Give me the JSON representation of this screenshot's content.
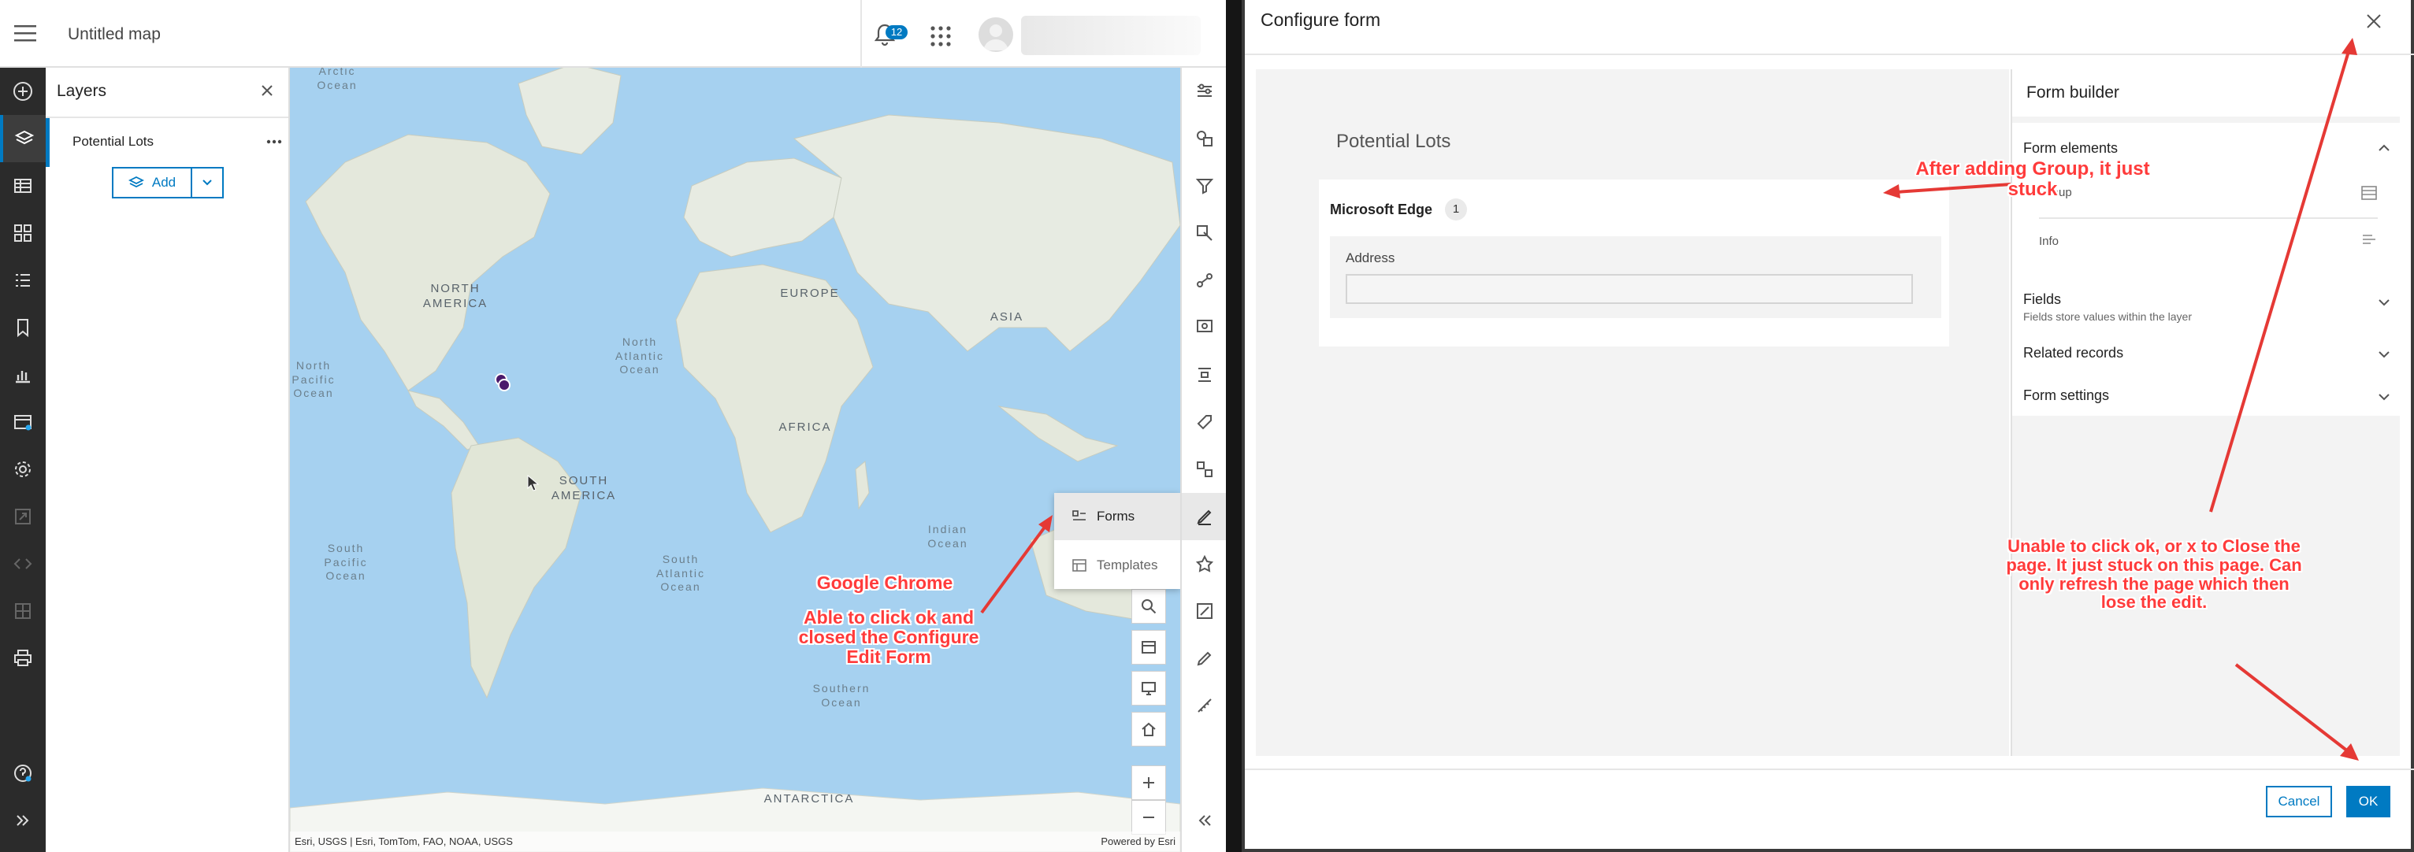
{
  "app": {
    "title": "Untitled map",
    "notification_count": "12"
  },
  "layers_panel": {
    "heading": "Layers",
    "layer_name": "Potential Lots",
    "add_label": "Add"
  },
  "map": {
    "ocean_labels": {
      "arctic": "Arctic\nOcean",
      "north_pacific": "North\nPacific\nOcean",
      "north_atlantic": "North\nAtlantic\nOcean",
      "south_pacific": "South\nPacific\nOcean",
      "south_atlantic": "South\nAtlantic\nOcean",
      "indian": "Indian\nOcean",
      "southern": "Southern\nOcean"
    },
    "continent_labels": {
      "north_america": "NORTH\nAMERICA",
      "south_america": "SOUTH\nAMERICA",
      "europe": "EUROPE",
      "asia": "ASIA",
      "africa": "AFRICA",
      "antarctica": "ANTARCTICA"
    },
    "attribution": "Esri, USGS | Esri, TomTom, FAO, NOAA, USGS",
    "powered_by": "Powered by Esri"
  },
  "popover": {
    "forms_label": "Forms",
    "templates_label": "Templates"
  },
  "dialog": {
    "title": "Configure form",
    "form_title": "Potential Lots",
    "group_name": "Microsoft Edge",
    "group_count": "1",
    "field_label": "Address",
    "cancel_label": "Cancel",
    "ok_label": "OK"
  },
  "builder": {
    "heading": "Form builder",
    "form_elements": {
      "title": "Form elements",
      "items": [
        "Group",
        "Info"
      ]
    },
    "fields": {
      "title": "Fields",
      "subtitle": "Fields store values within the layer"
    },
    "related_records": "Related records",
    "form_settings": "Form settings"
  },
  "annotations": {
    "chrome_title": "Google Chrome",
    "chrome_note": "Able to click ok and\nclosed the Configure\nEdit Form",
    "group_note": "After adding Group, it just stuck",
    "stuck_note": "Unable to click ok, or x to Close the\npage. It just stuck on this page. Can\nonly refresh the page which then\nlose the edit."
  },
  "colors": {
    "accent": "#007ac2",
    "annotation": "#ff3b3b",
    "ocean": "#a6d1f0",
    "land": "#e4e8dc"
  }
}
